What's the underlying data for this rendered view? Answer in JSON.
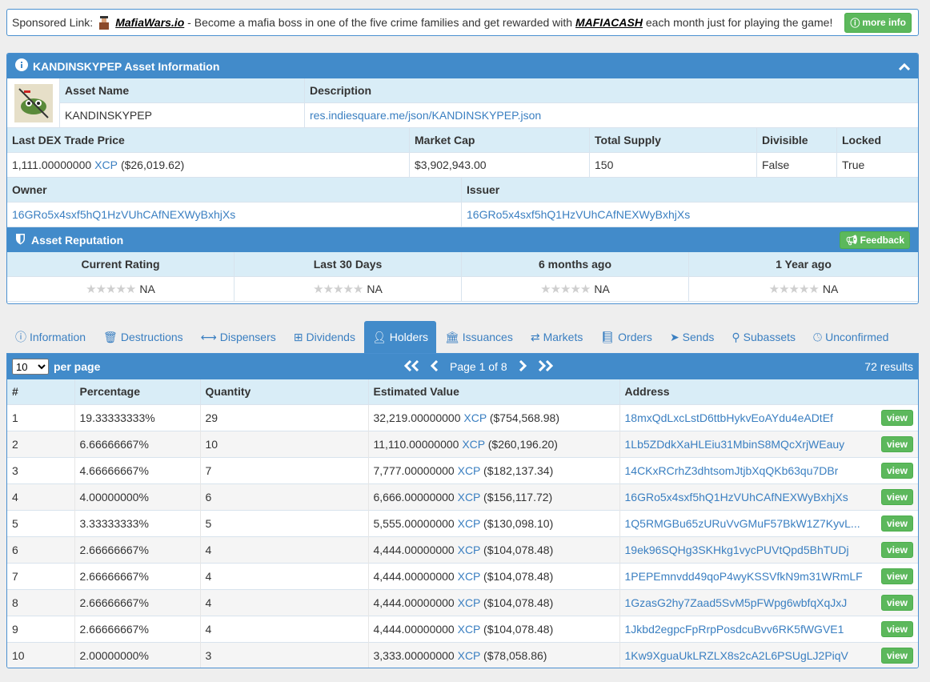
{
  "sponsor": {
    "prefix": "Sponsored Link:",
    "site": "MafiaWars.io",
    "text_mid": " - Become a mafia boss in one of the five crime families and get rewarded with ",
    "mafiacash": "MAFIACASH",
    "text_end": " each month just for playing the game!",
    "more_label": "more info"
  },
  "asset": {
    "title": "KANDINSKYPEP Asset Information",
    "name_header": "Asset Name",
    "desc_header": "Description",
    "name": "KANDINSKYPEP",
    "description": "res.indiesquare.me/json/KANDINSKYPEP.json",
    "headers": {
      "last_price": "Last DEX Trade Price",
      "market_cap": "Market Cap",
      "total_supply": "Total Supply",
      "divisible": "Divisible",
      "locked": "Locked",
      "owner": "Owner",
      "issuer": "Issuer"
    },
    "last_price_amount": "1,111.00000000",
    "last_price_unit": "XCP",
    "last_price_usd": "($26,019.62)",
    "market_cap": "$3,902,943.00",
    "total_supply": "150",
    "divisible": "False",
    "locked": "True",
    "owner": "16GRo5x4sxf5hQ1HzVUhCAfNEXWyBxhjXs",
    "issuer": "16GRo5x4sxf5hQ1HzVUhCAfNEXWyBxhjXs"
  },
  "reputation": {
    "title": "Asset Reputation",
    "feedback_label": "Feedback",
    "columns": [
      "Current Rating",
      "Last 30 Days",
      "6 months ago",
      "1 Year ago"
    ],
    "values": [
      "NA",
      "NA",
      "NA",
      "NA"
    ]
  },
  "tabs": [
    {
      "label": "Information",
      "icon": "info-icon"
    },
    {
      "label": "Destructions",
      "icon": "trash-icon"
    },
    {
      "label": "Dispensers",
      "icon": "arrows-h-icon"
    },
    {
      "label": "Dividends",
      "icon": "sitemap-icon"
    },
    {
      "label": "Holders",
      "icon": "user-icon",
      "active": true
    },
    {
      "label": "Issuances",
      "icon": "bank-icon"
    },
    {
      "label": "Markets",
      "icon": "exchange-icon"
    },
    {
      "label": "Orders",
      "icon": "book-icon"
    },
    {
      "label": "Sends",
      "icon": "send-icon"
    },
    {
      "label": "Subassets",
      "icon": "child-icon"
    },
    {
      "label": "Unconfirmed",
      "icon": "clock-icon"
    }
  ],
  "holders": {
    "per_page_value": "10",
    "per_page_label": "per page",
    "page_label": "Page 1 of 8",
    "results": "72 results",
    "columns": [
      "#",
      "Percentage",
      "Quantity",
      "Estimated Value",
      "Address"
    ],
    "view_label": "view",
    "rows": [
      {
        "n": "1",
        "pct": "19.33333333%",
        "qty": "29",
        "amt": "32,219.00000000",
        "unit": "XCP",
        "usd": "($754,568.98)",
        "addr": "18mxQdLxcLstD6ttbHykvEoAYdu4eADtEf"
      },
      {
        "n": "2",
        "pct": "6.66666667%",
        "qty": "10",
        "amt": "11,110.00000000",
        "unit": "XCP",
        "usd": "($260,196.20)",
        "addr": "1Lb5ZDdkXaHLEiu31MbinS8MQcXrjWEauy"
      },
      {
        "n": "3",
        "pct": "4.66666667%",
        "qty": "7",
        "amt": "7,777.00000000",
        "unit": "XCP",
        "usd": "($182,137.34)",
        "addr": "14CKxRCrhZ3dhtsomJtjbXqQKb63qu7DBr"
      },
      {
        "n": "4",
        "pct": "4.00000000%",
        "qty": "6",
        "amt": "6,666.00000000",
        "unit": "XCP",
        "usd": "($156,117.72)",
        "addr": "16GRo5x4sxf5hQ1HzVUhCAfNEXWyBxhjXs"
      },
      {
        "n": "5",
        "pct": "3.33333333%",
        "qty": "5",
        "amt": "5,555.00000000",
        "unit": "XCP",
        "usd": "($130,098.10)",
        "addr": "1Q5RMGBu65zURuVvGMuF57BkW1Z7KyvL..."
      },
      {
        "n": "6",
        "pct": "2.66666667%",
        "qty": "4",
        "amt": "4,444.00000000",
        "unit": "XCP",
        "usd": "($104,078.48)",
        "addr": "19ek96SQHg3SKHkg1vycPUVtQpd5BhTUDj"
      },
      {
        "n": "7",
        "pct": "2.66666667%",
        "qty": "4",
        "amt": "4,444.00000000",
        "unit": "XCP",
        "usd": "($104,078.48)",
        "addr": "1PEPEmnvdd49qoP4wyKSSVfkN9m31WRmLF"
      },
      {
        "n": "8",
        "pct": "2.66666667%",
        "qty": "4",
        "amt": "4,444.00000000",
        "unit": "XCP",
        "usd": "($104,078.48)",
        "addr": "1GzasG2hy7Zaad5SvM5pFWpg6wbfqXqJxJ"
      },
      {
        "n": "9",
        "pct": "2.66666667%",
        "qty": "4",
        "amt": "4,444.00000000",
        "unit": "XCP",
        "usd": "($104,078.48)",
        "addr": "1Jkbd2egpcFpRrpPosdcuBvv6RK5fWGVE1"
      },
      {
        "n": "10",
        "pct": "2.00000000%",
        "qty": "3",
        "amt": "3,333.00000000",
        "unit": "XCP",
        "usd": "($78,058.86)",
        "addr": "1Kw9XguaUkLRZLX8s2cA2L6PSUgLJ2PiqV"
      }
    ]
  },
  "colors": {
    "primary": "#428bca",
    "header_bg": "#d9edf7",
    "link": "#3a7fc1",
    "green": "#5cb85c"
  }
}
